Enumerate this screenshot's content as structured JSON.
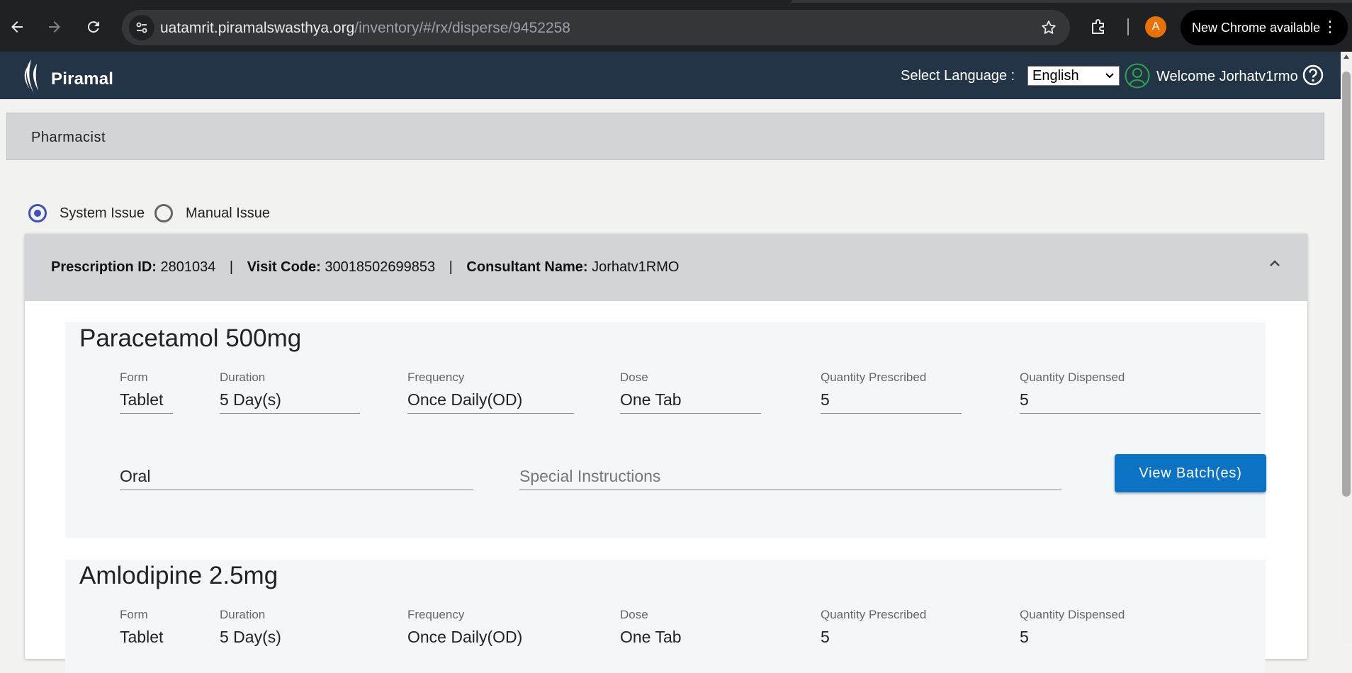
{
  "browser": {
    "url_host": "uatamrit.piramalswasthya.org",
    "url_path": "/inventory/#/rx/disperse/9452258",
    "profile_initial": "A",
    "update_label": "New Chrome available"
  },
  "header": {
    "logo_text": "Piramal",
    "language_label": "Select Language :",
    "language_value": "English",
    "welcome_label": "Welcome",
    "user_name": "Jorhatv1rmo"
  },
  "page": {
    "role_title": "Pharmacist",
    "issue_options": [
      {
        "label": "System Issue",
        "selected": true
      },
      {
        "label": "Manual Issue",
        "selected": false
      }
    ]
  },
  "prescription": {
    "id_label": "Prescription ID:",
    "id": "2801034",
    "visit_label": "Visit Code:",
    "visit_code": "30018502699853",
    "consultant_label": "Consultant Name:",
    "consultant": "Jorhatv1RMO",
    "separator": "|"
  },
  "field_labels": {
    "form": "Form",
    "duration": "Duration",
    "frequency": "Frequency",
    "dose": "Dose",
    "qty_prescribed": "Quantity Prescribed",
    "qty_dispensed": "Quantity Dispensed",
    "special_placeholder": "Special Instructions",
    "batch_button": "View Batch(es)"
  },
  "drugs": [
    {
      "name": "Paracetamol 500mg",
      "form": "Tablet",
      "duration": "5 Day(s)",
      "frequency": "Once Daily(OD)",
      "dose": "One Tab",
      "qty_prescribed": "5",
      "qty_dispensed": "5",
      "route": "Oral",
      "special_instructions": ""
    },
    {
      "name": "Amlodipine 2.5mg",
      "form": "Tablet",
      "duration": "5 Day(s)",
      "frequency": "Once Daily(OD)",
      "dose": "One Tab",
      "qty_prescribed": "5",
      "qty_dispensed": "5"
    }
  ],
  "colors": {
    "header_bg": "#243447",
    "accent_button": "#0b72c4",
    "radio_selected": "#3f51b5"
  },
  "icons": [
    "back-icon",
    "forward-icon",
    "reload-icon",
    "site-info-icon",
    "bookmark-star-icon",
    "extensions-icon",
    "user-icon",
    "help-icon",
    "chevron-up-icon"
  ]
}
